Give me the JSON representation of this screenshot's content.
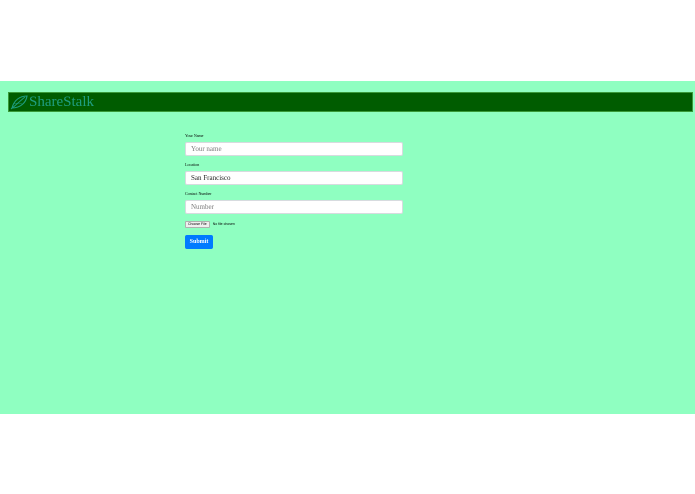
{
  "brand": {
    "name": "ShareStalk",
    "icon": "leaf-icon"
  },
  "form": {
    "name": {
      "label": "Your Name",
      "placeholder": "Your name",
      "value": ""
    },
    "location": {
      "label": "Location",
      "placeholder": "",
      "value": "San Francisco"
    },
    "contact": {
      "label": "Contact Number",
      "placeholder": "Number",
      "value": ""
    },
    "file": {
      "button_label": "Choose File",
      "status": "No file chosen"
    },
    "submit_label": "Submit"
  },
  "colors": {
    "page_bg": "#8fffc1",
    "navbar_bg": "#005c00",
    "brand_text": "#1f9e80",
    "submit_bg": "#007bff"
  }
}
